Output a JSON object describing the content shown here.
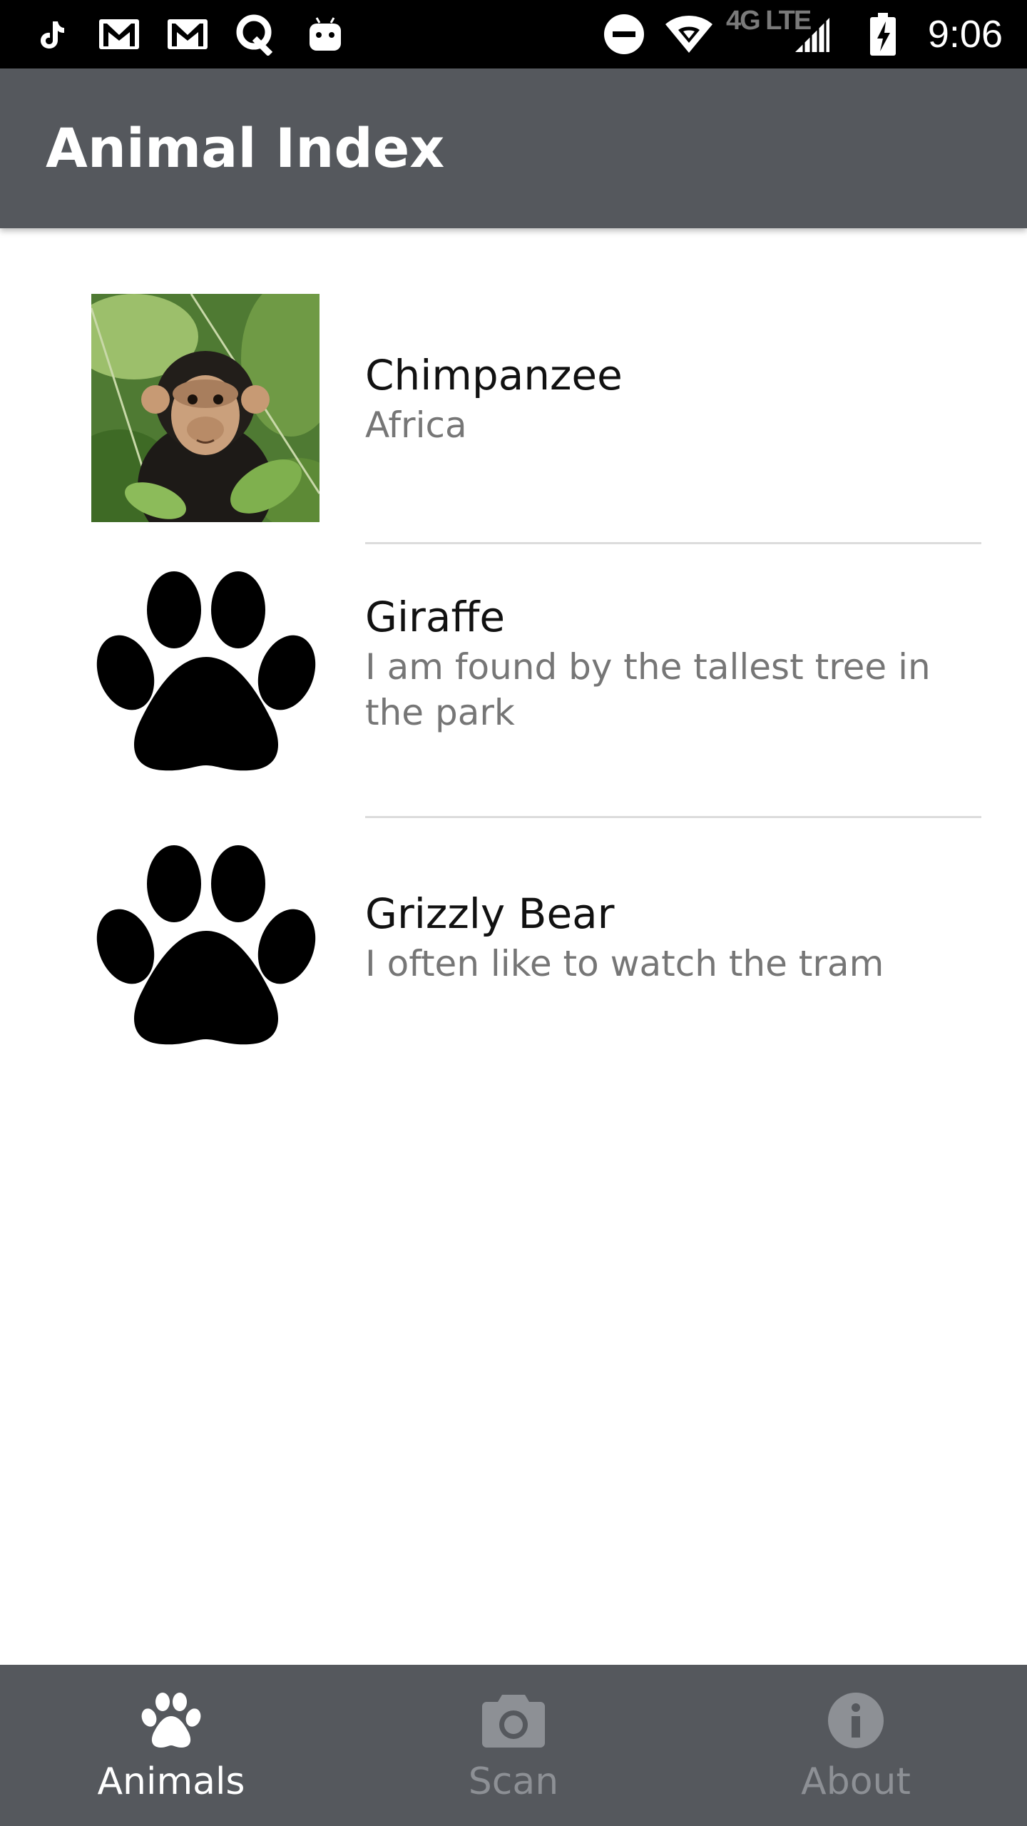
{
  "status_bar": {
    "time": "9:06",
    "network": "4G LTE",
    "left_icons": [
      "tiktok-icon",
      "gmail-icon",
      "gmail-icon",
      "quora-icon",
      "android-icon"
    ],
    "right_icons": [
      "do-not-disturb-icon",
      "wifi-icon",
      "signal-icon",
      "battery-charging-icon"
    ]
  },
  "app_bar": {
    "title": "Animal Index"
  },
  "animals": [
    {
      "name": "Chimpanzee",
      "description": "Africa",
      "image": "chimpanzee-photo"
    },
    {
      "name": "Giraffe",
      "description": "I am found by the tallest tree in the park",
      "image": "paw-icon"
    },
    {
      "name": "Grizzly Bear",
      "description": "I often like to watch the tram",
      "image": "paw-icon"
    }
  ],
  "bottom_nav": {
    "items": [
      {
        "label": "Animals",
        "icon": "paw-icon",
        "active": true
      },
      {
        "label": "Scan",
        "icon": "camera-icon",
        "active": false
      },
      {
        "label": "About",
        "icon": "info-icon",
        "active": false
      }
    ]
  },
  "colors": {
    "app_bar": "#55585d",
    "status_bar": "#000000",
    "nav_active": "#ffffff",
    "nav_inactive": "#8d9095",
    "description_text": "#767676"
  }
}
